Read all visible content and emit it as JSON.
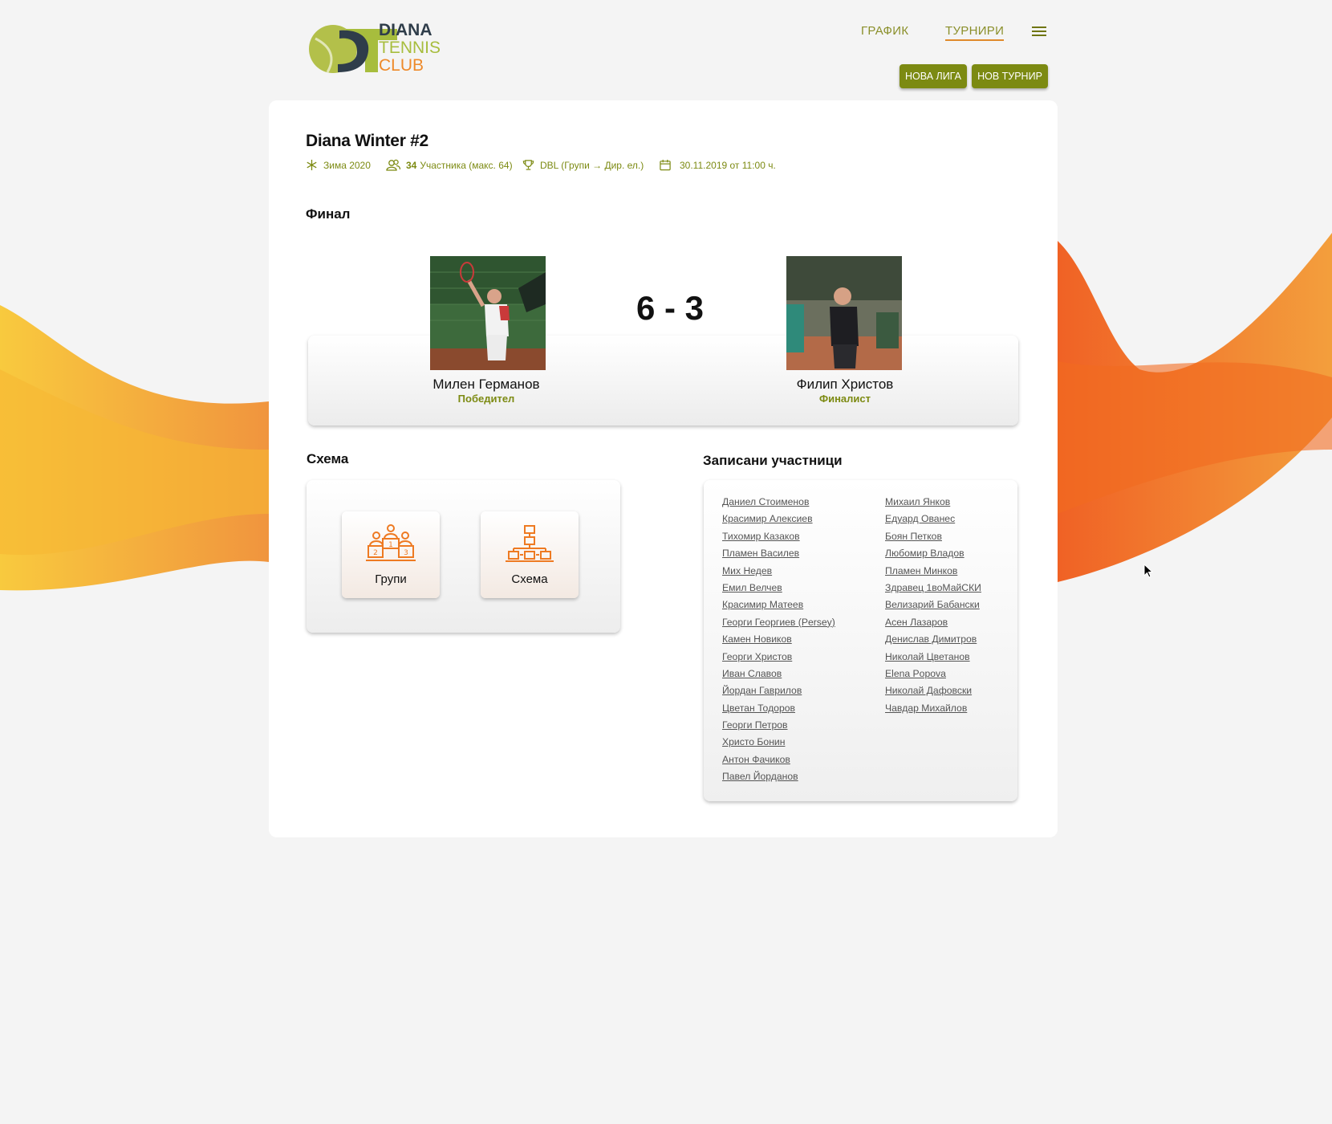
{
  "brand": {
    "line1": "DIANA",
    "line2": "TENNIS",
    "line3": "CLUB"
  },
  "nav": {
    "schedule": "ГРАФИК",
    "tournaments": "ТУРНИРИ"
  },
  "actions": {
    "new_league": "НОВА ЛИГА",
    "new_tournament": "НОВ ТУРНИР"
  },
  "tournament": {
    "title": "Diana Winter #2",
    "season": "Зима 2020",
    "participants_count": "34",
    "participants_label": "Участника (макс. 64)",
    "format": "DBL (Групи → Дир. ел.)",
    "date": "30.11.2019 от 11:00 ч."
  },
  "final": {
    "heading": "Финал",
    "score": "6 - 3",
    "winner": {
      "name": "Милен Германов",
      "role": "Победител"
    },
    "finalist": {
      "name": "Филип Христов",
      "role": "Финалист"
    }
  },
  "schema": {
    "heading": "Схема",
    "groups_label": "Групи",
    "bracket_label": "Схема"
  },
  "participants": {
    "heading": "Записани участници",
    "col1": [
      "Даниел Стоименов",
      "Красимир Алексиев",
      "Тихомир Казаков",
      "Пламен Василев",
      "Мих Недев",
      "Емил Велчев",
      "Красимир Матеев",
      "Георги Георгиев (Persey)",
      "Камен Новиков",
      "Георги Христов",
      "Иван Славов",
      "Йордан Гаврилов",
      "Цветан Тодоров",
      "Георги Петров",
      "Христо Бонин",
      "Антон Фачиков",
      "Павел Йорданов"
    ],
    "col2": [
      "Михаил Янков",
      "Едуард Ованес",
      "Боян Петков",
      "Любомир Владов",
      "Пламен Минков",
      "Здравец 1воМайСКИ",
      "Велизарий Бабански",
      "Асен Лазаров",
      "Денислав Димитров",
      "Николай Цветанов",
      "Elena Popova",
      "Николай Дафовски",
      "Чавдар Михайлов"
    ]
  },
  "colors": {
    "accent": "#7c8a12",
    "orange": "#ee7a22",
    "background": "#f4f4f4"
  }
}
